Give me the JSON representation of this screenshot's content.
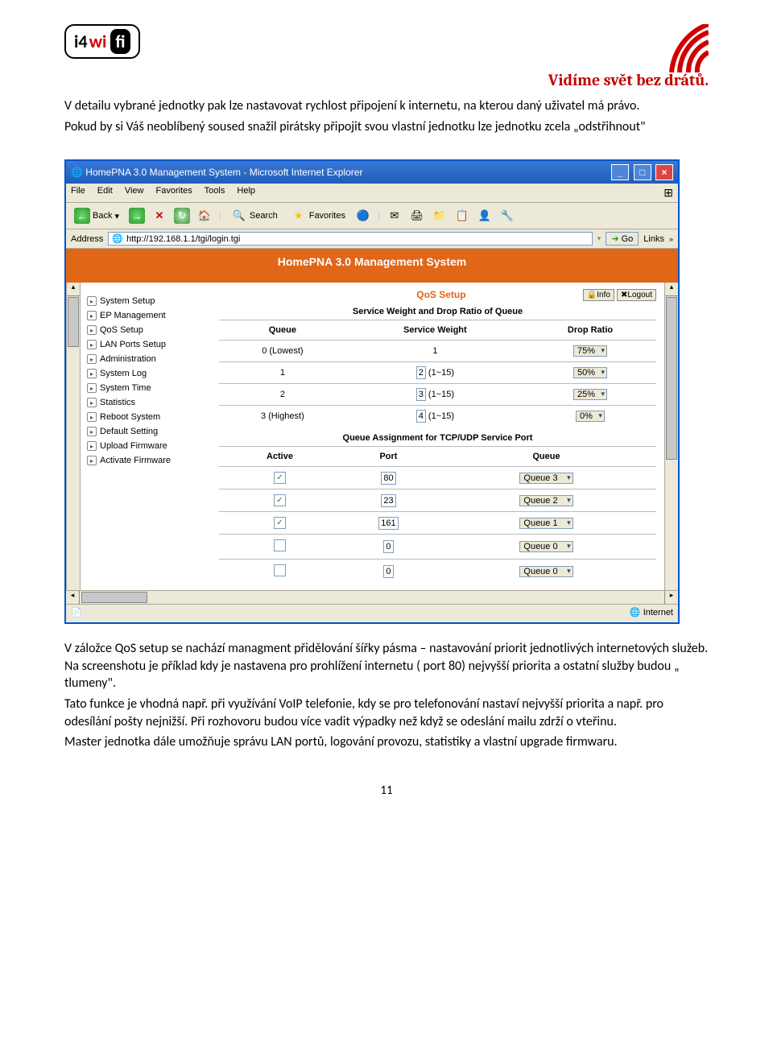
{
  "logo": {
    "i4": "i4",
    "wi": "wi",
    "fi": "fi"
  },
  "slogan": "Vidíme svět bez drátů.",
  "intro_p1": "V detailu vybrané jednotky pak lze nastavovat rychlost připojení k internetu, na kterou daný uživatel má právo.",
  "intro_p2": "Pokud by si Váš neoblíbený soused snažil pirátsky připojit svou vlastní jednotku lze jednotku zcela „odstřihnout\"",
  "browser": {
    "title": "HomePNA 3.0 Management System - Microsoft Internet Explorer",
    "menus": [
      "File",
      "Edit",
      "View",
      "Favorites",
      "Tools",
      "Help"
    ],
    "back": "Back",
    "search": "Search",
    "favorites": "Favorites",
    "address_label": "Address",
    "url": "http://192.168.1.1/tgi/login.tgi",
    "go": "Go",
    "links": "Links",
    "banner": "HomePNA 3.0 Management System",
    "status_internet": "Internet"
  },
  "sidebar": [
    "System Setup",
    "EP Management",
    "QoS Setup",
    "LAN Ports Setup",
    "Administration",
    "System Log",
    "System Time",
    "Statistics",
    "Reboot System",
    "Default Setting",
    "Upload Firmware",
    "Activate Firmware"
  ],
  "qos": {
    "title": "QoS Setup",
    "info": "Info",
    "logout": "Logout",
    "sec1": "Service Weight and Drop Ratio of Queue",
    "cols1": [
      "Queue",
      "Service Weight",
      "Drop Ratio"
    ],
    "rows1": [
      {
        "queue": "0 (Lowest)",
        "weight": "1",
        "weight_hint": "",
        "drop": "75%"
      },
      {
        "queue": "1",
        "weight": "2",
        "weight_hint": "(1~15)",
        "drop": "50%"
      },
      {
        "queue": "2",
        "weight": "3",
        "weight_hint": "(1~15)",
        "drop": "25%"
      },
      {
        "queue": "3 (Highest)",
        "weight": "4",
        "weight_hint": "(1~15)",
        "drop": "0%"
      }
    ],
    "sec2": "Queue Assignment for TCP/UDP Service Port",
    "cols2": [
      "Active",
      "Port",
      "Queue"
    ],
    "rows2": [
      {
        "active": true,
        "port": "80",
        "queue": "Queue 3"
      },
      {
        "active": true,
        "port": "23",
        "queue": "Queue 2"
      },
      {
        "active": true,
        "port": "161",
        "queue": "Queue 1"
      },
      {
        "active": false,
        "port": "0",
        "queue": "Queue 0"
      },
      {
        "active": false,
        "port": "0",
        "queue": "Queue 0"
      }
    ]
  },
  "outro_p1": "V záložce QoS setup se nachází managment přidělování šířky pásma – nastavování priorit jednotlivých internetových služeb. Na screenshotu je příklad kdy je nastavena pro prohlížení internetu ( port 80) nejvyšší priorita a ostatní služby budou „ tlumeny\".",
  "outro_p2": "Tato funkce je vhodná např. při využívání VoIP telefonie, kdy se pro telefonování nastaví nejvyšší priorita  a např. pro odesílání pošty nejnižší. Při rozhovoru budou více vadit výpadky než když se odeslání mailu zdrží o vteřinu.",
  "outro_p3": "Master jednotka dále umožňuje správu LAN portů, logování provozu, statistiky a vlastní upgrade firmwaru.",
  "pagenum": "11"
}
